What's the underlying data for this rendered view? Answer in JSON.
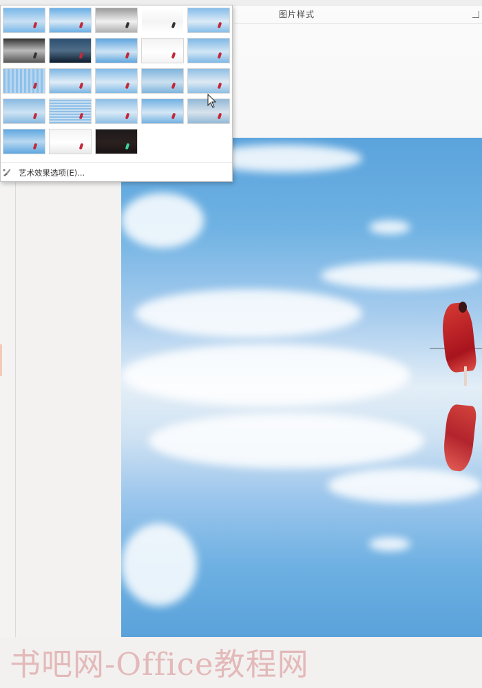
{
  "ribbon": {
    "group_label": "图片样式"
  },
  "art_effects_gallery": {
    "thumbnails": [
      "art-effect-none",
      "art-effect-marker",
      "art-effect-pencil-grayscale",
      "art-effect-pencil-sketch",
      "art-effect-line-drawing",
      "art-effect-chalk-sketch",
      "art-effect-paint-strokes",
      "art-effect-paint-brush",
      "art-effect-glow-diffused",
      "art-effect-blur",
      "art-effect-light-screen",
      "art-effect-watercolor-sponge",
      "art-effect-film-grain",
      "art-effect-mosaic-bubbles",
      "art-effect-glass",
      "art-effect-cement",
      "art-effect-texturizer",
      "art-effect-crisscross-etching",
      "art-effect-pastels-smooth",
      "art-effect-plastic-wrap",
      "art-effect-cutout",
      "art-effect-photocopy",
      "art-effect-glow-edges"
    ],
    "options_label": "艺术效果选项(E)..."
  },
  "watermark": {
    "text": "书吧网-Office教程网"
  },
  "colors": {
    "sky_top": "#5aa3dc",
    "sky_mid": "#e3eef7",
    "dress_red": "#c2202a",
    "watermark": "#e3b9b9"
  }
}
